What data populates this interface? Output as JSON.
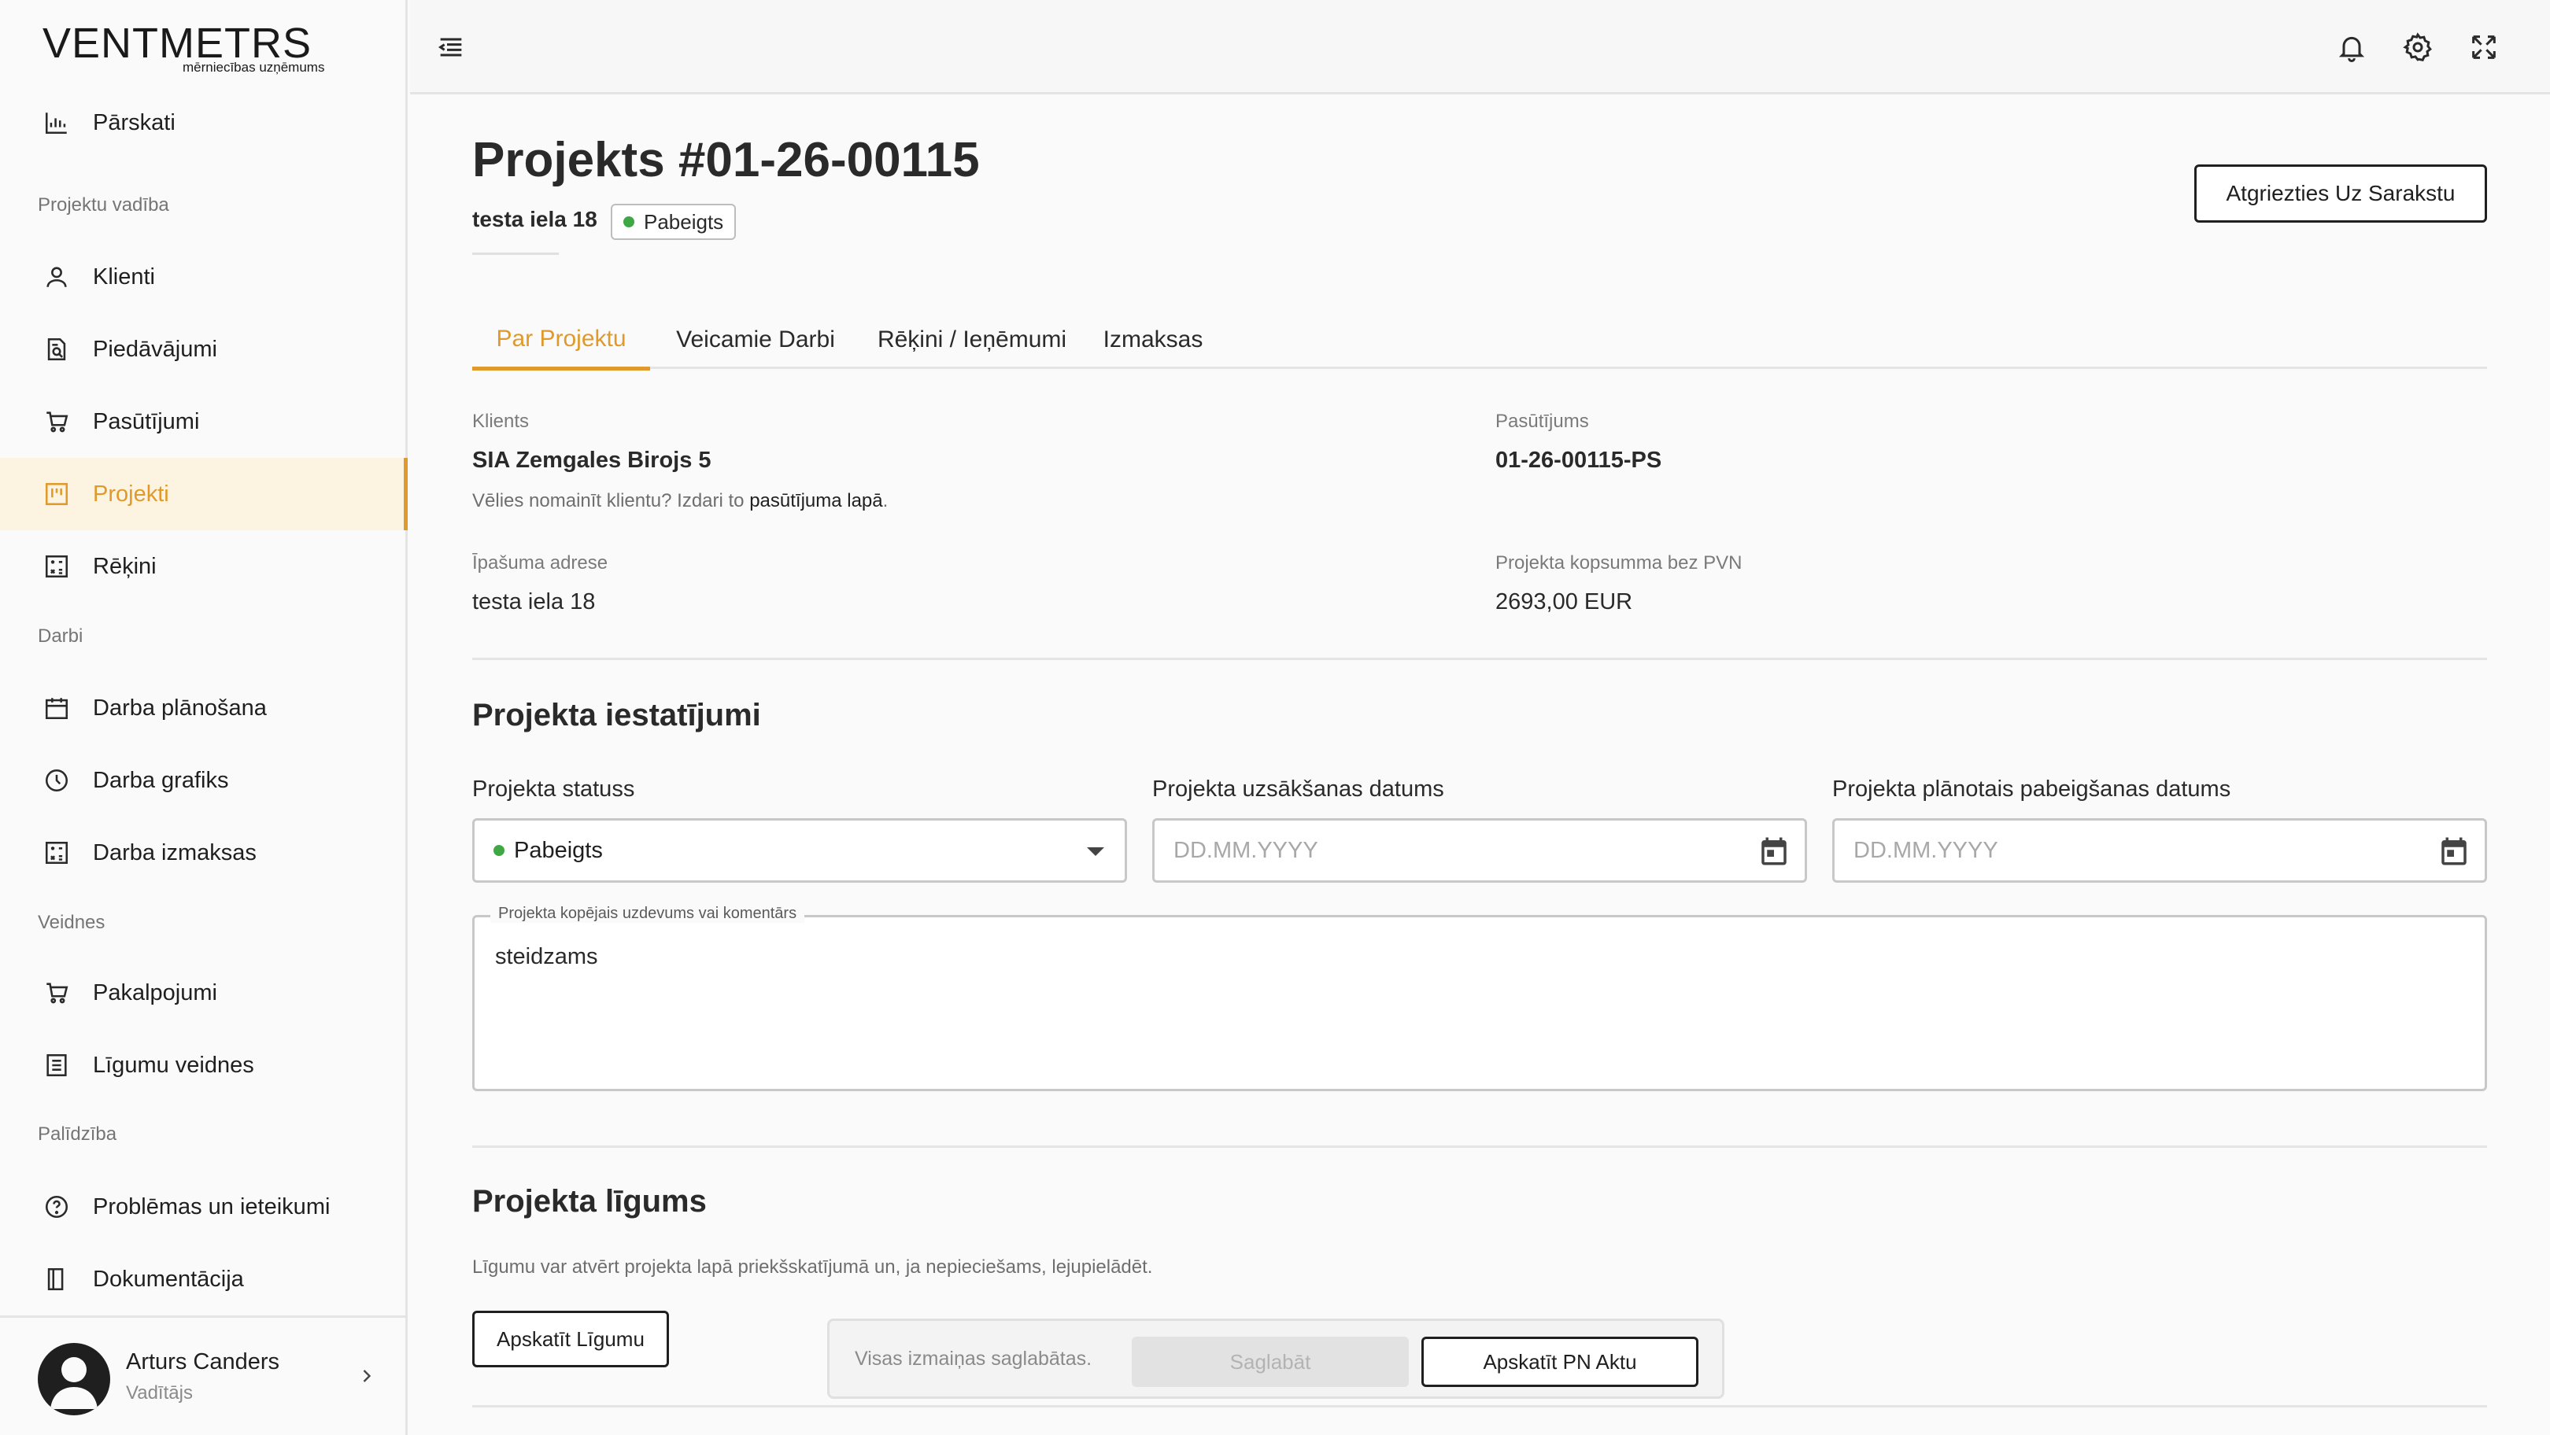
{
  "sidebar": {
    "logo_main": "VENTMETRS",
    "logo_sub": "mērniecības uzņēmums",
    "items": {
      "parskati": "Pārskati",
      "klienti": "Klienti",
      "piedavajumi": "Piedāvājumi",
      "pasutijumi": "Pasūtījumi",
      "projekti": "Projekti",
      "rekini": "Rēķini",
      "darba_planosana": "Darba plānošana",
      "darba_grafiks": "Darba grafiks",
      "darba_izmaksas": "Darba izmaksas",
      "pakalpojumi": "Pakalpojumi",
      "ligumu_veidnes": "Līgumu veidnes",
      "problemas": "Problēmas un ieteikumi",
      "dokumentacija": "Dokumentācija"
    },
    "sections": {
      "projektu_vadiba": "Projektu vadība",
      "darbi": "Darbi",
      "veidnes": "Veidnes",
      "palidziba": "Palīdzība"
    },
    "active_item": "Projekti",
    "user": {
      "name": "Arturs Canders",
      "role": "Vadītājs"
    }
  },
  "header": {
    "icons": [
      "menu-collapse-icon",
      "bell-icon",
      "gear-icon",
      "fullscreen-icon"
    ]
  },
  "project": {
    "title": "Projekts #01-26-00115",
    "address_short": "testa iela 18",
    "status_badge": "Pabeigts",
    "back_button": "Atgriezties Uz Sarakstu"
  },
  "tabs": [
    "Par Projektu",
    "Veicamie Darbi",
    "Rēķini / Ieņēmumi",
    "Izmaksas"
  ],
  "active_tab": "Par Projektu",
  "info": {
    "client_label": "Klients",
    "client_value": "SIA Zemgales Birojs 5",
    "client_hint_prefix": "Vēlies nomainīt klientu? Izdari to",
    "client_hint_link": "pasūtījuma lapā",
    "client_hint_suffix": ".",
    "order_label": "Pasūtījums",
    "order_value": "01-26-00115-PS",
    "property_label": "Īpašuma adrese",
    "property_value": "testa iela 18",
    "total_label": "Projekta kopsumma bez PVN",
    "total_value": "2693,00 EUR"
  },
  "settings": {
    "title": "Projekta iestatījumi",
    "status_label": "Projekta statuss",
    "status_value": "Pabeigts",
    "start_label": "Projekta uzsākšanas datums",
    "start_placeholder": "DD.MM.YYYY",
    "end_label": "Projekta plānotais pabeigšanas datums",
    "end_placeholder": "DD.MM.YYYY",
    "comment_label": "Projekta kopējais uzdevums vai komentārs",
    "comment_value": "steidzams"
  },
  "contract": {
    "title": "Projekta līgums",
    "description": "Līgumu var atvērt projekta lapā priekšskatījumā un, ja nepieciešams, lejupielādēt.",
    "view_contract_button": "Apskatīt Līgumu",
    "save_status": "Visas izmaiņas saglabātas.",
    "save_button": "Saglabāt",
    "view_pn_button": "Apskatīt PN Aktu"
  },
  "colors": {
    "accent": "#e09a2b",
    "status_green": "#3ea845"
  }
}
